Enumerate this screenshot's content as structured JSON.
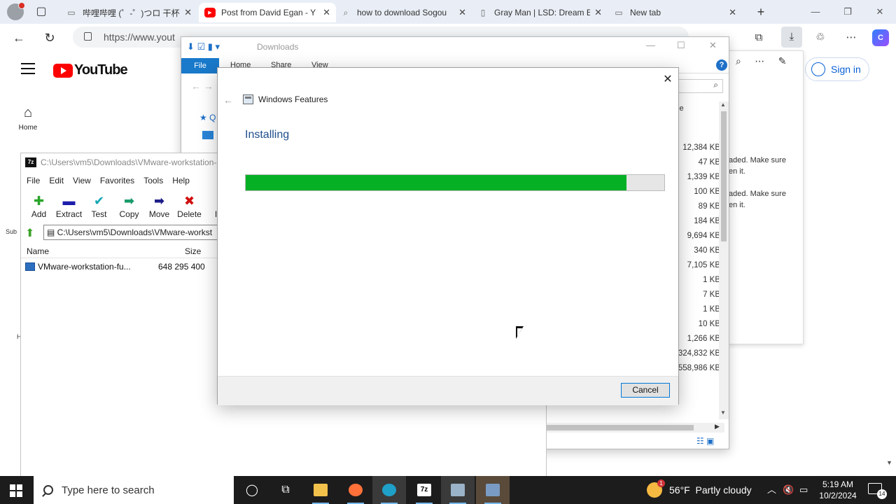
{
  "browser": {
    "tabs": [
      {
        "title": "哔哩哔哩 (゜-゜)つロ 干杯~",
        "icon": "page-icon"
      },
      {
        "title": "Post from David Egan - Y",
        "icon": "youtube-icon"
      },
      {
        "title": "how to download Sogou",
        "icon": "search-icon"
      },
      {
        "title": "Gray Man | LSD: Dream E",
        "icon": "page-icon"
      },
      {
        "title": "New tab",
        "icon": "page-icon"
      }
    ],
    "url": "https://www.youtube.com/post/UgkxU0Y...",
    "url_visible": "https://www.yout"
  },
  "youtube": {
    "logo_text": "YouTube",
    "home_label": "Home",
    "subs_fragment": "Sub",
    "h_fragment": "H",
    "signin_label": "Sign in"
  },
  "flyout": {
    "msg1": "aded. Make sure en it.",
    "msg2": "aded. Make sure en it."
  },
  "explorer": {
    "title": "Downloads",
    "ribbon": {
      "file": "File",
      "home": "Home",
      "share": "Share",
      "view": "View"
    },
    "quick_access_fragment": "Q",
    "size_header": "ze",
    "sizes": [
      "12,384 KB",
      "47 KB",
      "1,339 KB",
      "100 KB",
      "89 KB",
      "184 KB",
      "9,694 KB",
      "340 KB",
      "7,105 KB",
      "1 KB",
      "7 KB",
      "1 KB",
      "10 KB",
      "1,266 KB",
      "324,832 KB",
      "558,986 KB"
    ]
  },
  "sevenzip": {
    "title": "C:\\Users\\vm5\\Downloads\\VMware-workstation-",
    "menu": [
      "File",
      "Edit",
      "View",
      "Favorites",
      "Tools",
      "Help"
    ],
    "tools": [
      {
        "label": "Add",
        "icon": "plus-icon",
        "color": "#2aa52a"
      },
      {
        "label": "Extract",
        "icon": "minus-icon",
        "color": "#1d1dab"
      },
      {
        "label": "Test",
        "icon": "check-icon",
        "color": "#12a6b5"
      },
      {
        "label": "Copy",
        "icon": "copy-arrow-icon",
        "color": "#1a9a6a"
      },
      {
        "label": "Move",
        "icon": "move-arrow-icon",
        "color": "#1d1d8a"
      },
      {
        "label": "Delete",
        "icon": "x-icon",
        "color": "#d01010"
      },
      {
        "label": "Inf",
        "icon": "info-icon",
        "color": "#c9a400"
      }
    ],
    "path": "C:\\Users\\vm5\\Downloads\\VMware-workst",
    "columns": {
      "name": "Name",
      "size": "Size"
    },
    "files": [
      {
        "name": "VMware-workstation-fu...",
        "size": "648 295 400"
      }
    ]
  },
  "dialog": {
    "title": "Windows Features",
    "status": "Installing",
    "progress": 0.91,
    "cancel_label": "Cancel"
  },
  "taskbar": {
    "search_placeholder": "Type here to search",
    "weather_temp": "56°F",
    "weather_desc": "Partly cloudy",
    "time": "5:19 AM",
    "date": "10/2/2024",
    "notifications": "14"
  },
  "colors": {
    "progress_fill": "#06b025",
    "accent": "#0078d7",
    "youtube_red": "#ff0000"
  }
}
